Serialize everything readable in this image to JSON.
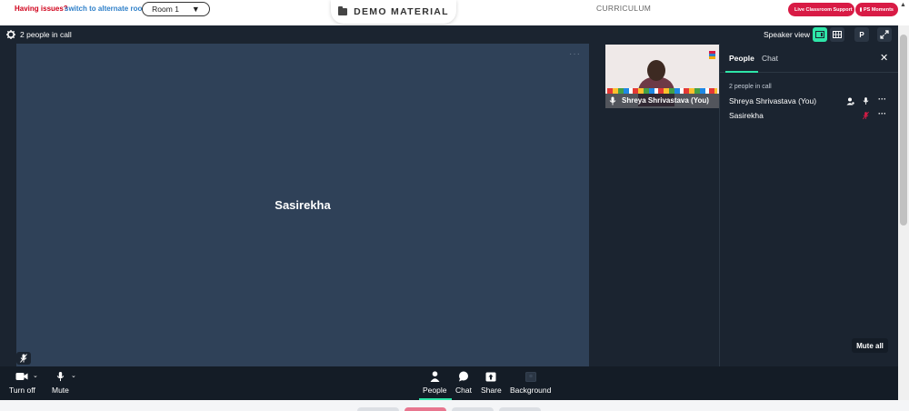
{
  "topbar": {
    "issues_text": "Having issues?",
    "switch_link": "switch to alternate room",
    "room_select": {
      "value": "Room 1",
      "caret": "▼"
    },
    "demo_button": "DEMO MATERIAL",
    "curriculum": "CURRICULUM",
    "support_pill": "Live Classroom Support",
    "moments_pill": "PS Moments"
  },
  "call": {
    "header": {
      "people_count": "2 people in call",
      "view_label": "Speaker view",
      "p_button": "P"
    },
    "main_tile": {
      "name": "Sasirekha",
      "more": "···"
    },
    "self_tile": {
      "name": "Shreya Shrivastava (You)"
    },
    "side_panel": {
      "tabs": {
        "people": "People",
        "chat": "Chat"
      },
      "count": "2 people in call",
      "people": [
        {
          "name": "Shreya Shrivastava (You)",
          "mic": "on"
        },
        {
          "name": "Sasirekha",
          "mic": "muted"
        }
      ],
      "more": "···",
      "mute_all": "Mute all"
    },
    "controls": {
      "turn_off": "Turn off",
      "mute": "Mute",
      "people": "People",
      "chat": "Chat",
      "share": "Share",
      "background": "Background"
    },
    "colors": {
      "accent": "#2ee6a8",
      "tile_bg": "#2f4158",
      "dark_bg": "#1b2430",
      "brand_red": "#d81b45"
    }
  },
  "icons": [
    "gear-icon",
    "folder-icon",
    "speaker-view-icon",
    "grid-view-icon",
    "fullscreen-icon",
    "close-icon",
    "mic-icon",
    "mic-off-icon",
    "camera-icon",
    "person-icon",
    "chat-bubble-icon",
    "share-icon",
    "background-icon",
    "more-icon"
  ]
}
